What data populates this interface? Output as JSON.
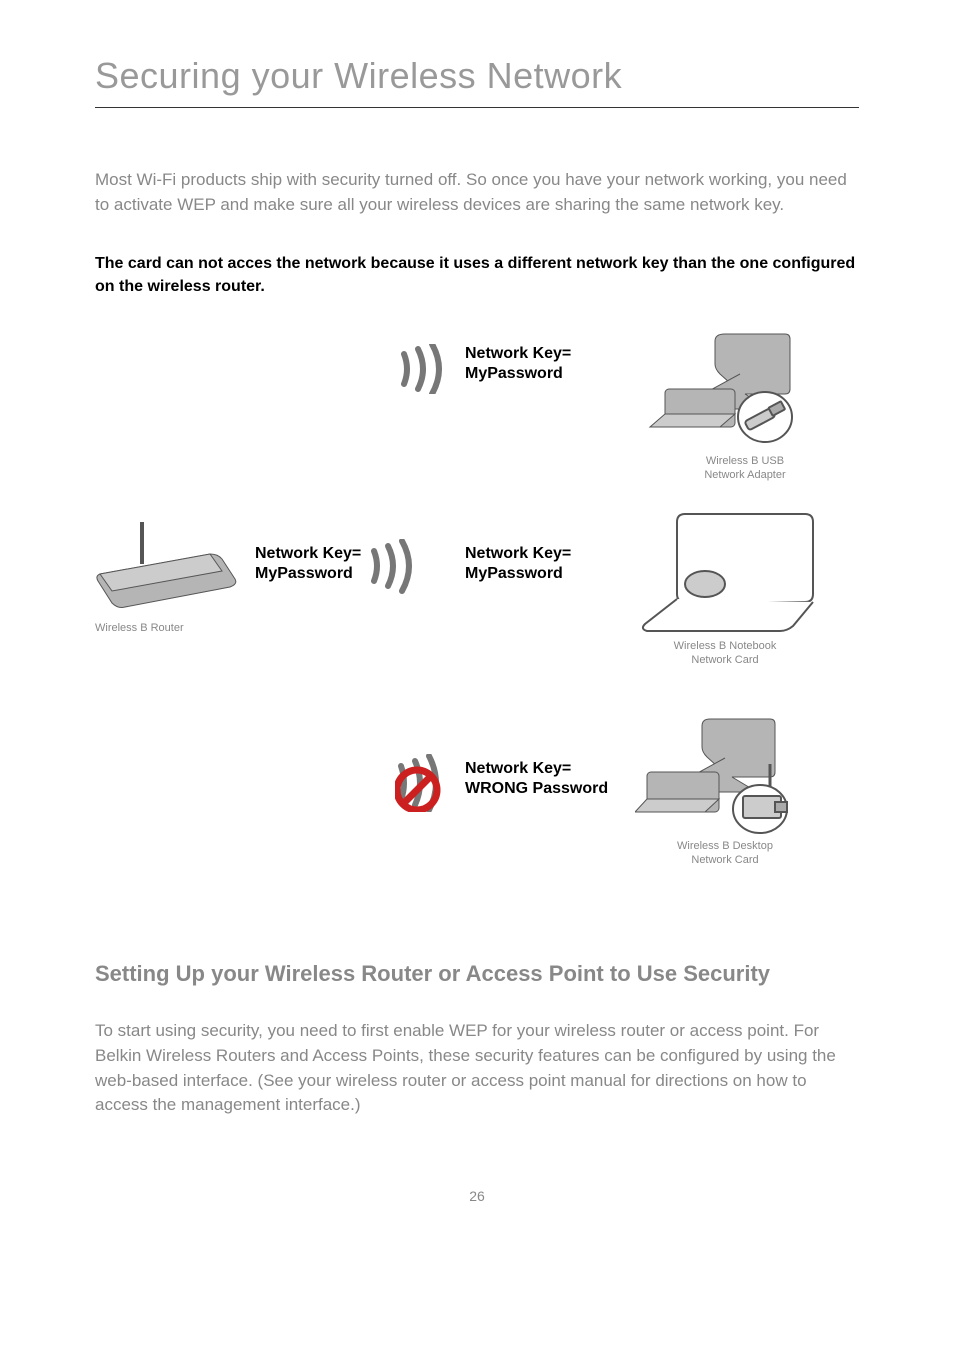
{
  "title": "Securing your Wireless Network",
  "intro": "Most Wi-Fi products ship with security turned off. So once you have your network working, you need to activate WEP and make sure all your wireless devices are sharing the same network key.",
  "caption": "The card can not acces the network because it uses a different network key than the one configured on the wireless router.",
  "diagram": {
    "key_top": "Network Key=\nMyPassword",
    "key_router": "Network Key=\nMyPassword",
    "key_mid": "Network Key=\nMyPassword",
    "key_bottom": "Network Key=\nWRONG Password",
    "dev_router": "Wireless B Router",
    "dev_usb": "Wireless B USB\nNetwork Adapter",
    "dev_notebook": "Wireless B Notebook\nNetwork Card",
    "dev_desktop": "Wireless B Desktop\nNetwork Card"
  },
  "subhead": "Setting Up your Wireless Router or Access Point to Use Security",
  "body": "To start using security, you need to first enable WEP for your wireless router or access point. For Belkin Wireless Routers and Access Points, these security features can be configured by using the web-based interface. (See your wireless router or access point manual for directions on how to access the management interface.)",
  "pagenum": "26"
}
